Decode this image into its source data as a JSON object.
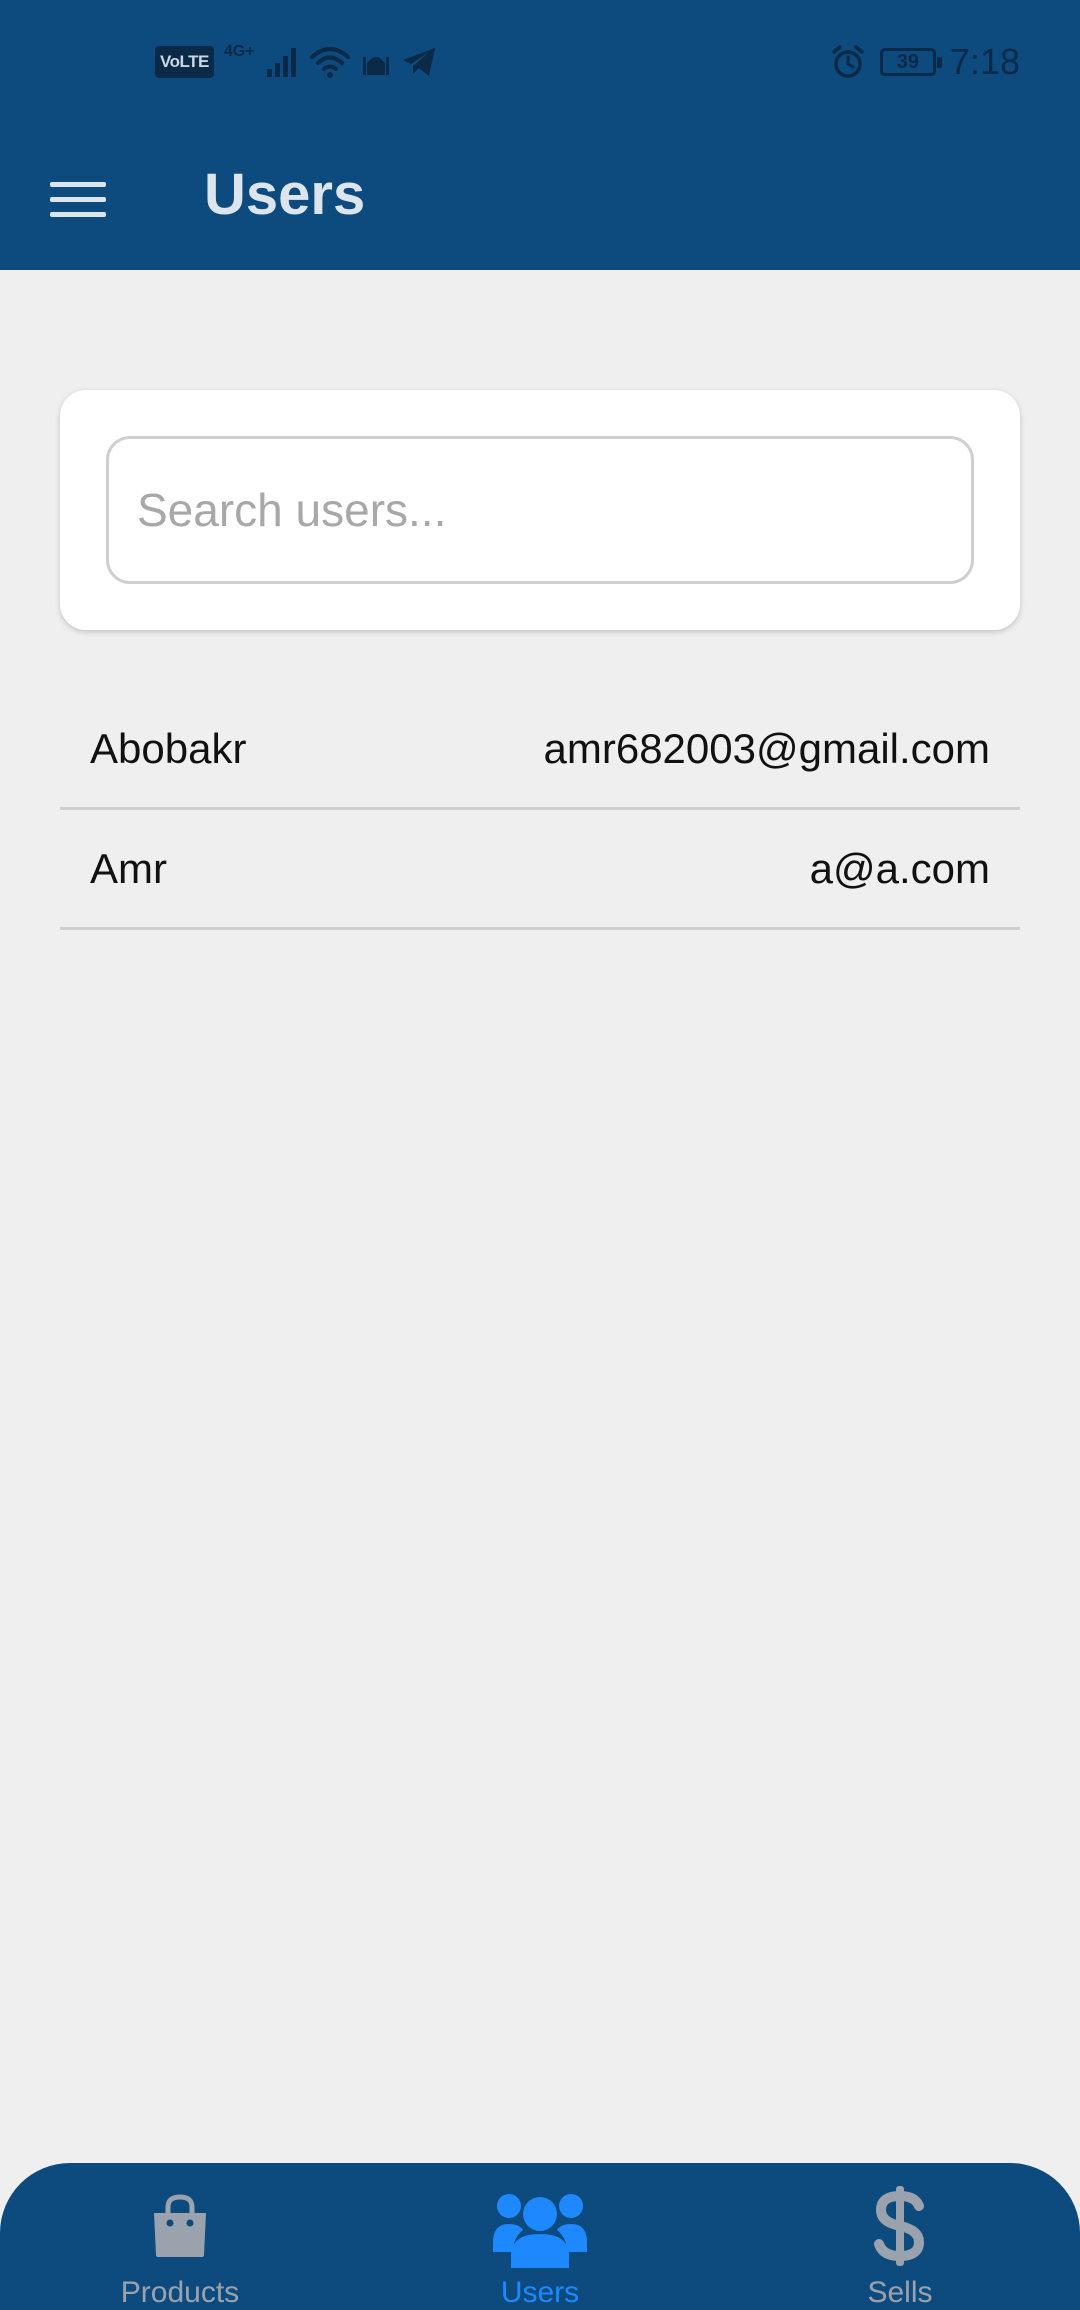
{
  "status_bar": {
    "volte": "VoLTE",
    "network": "4G+",
    "battery": "39",
    "time": "7:18"
  },
  "app_bar": {
    "title": "Users",
    "menu_icon": "hamburger-menu-icon"
  },
  "search": {
    "placeholder": "Search users...",
    "value": ""
  },
  "users": [
    {
      "name": "Abobakr",
      "email": "amr682003@gmail.com"
    },
    {
      "name": "Amr",
      "email": "a@a.com"
    }
  ],
  "bottom_nav": {
    "items": [
      {
        "label": "Products",
        "icon": "shopping-bag-icon",
        "active": false
      },
      {
        "label": "Users",
        "icon": "users-icon",
        "active": true
      },
      {
        "label": "Sells",
        "icon": "dollar-icon",
        "active": false
      }
    ]
  },
  "colors": {
    "primary": "#0d4a7d",
    "active": "#1e88ff",
    "inactive": "#9aa3ad",
    "background": "#efefef"
  }
}
